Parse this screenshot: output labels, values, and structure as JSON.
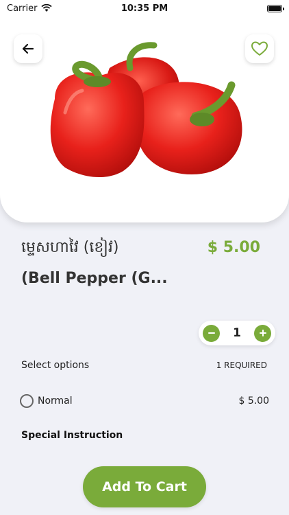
{
  "status_bar": {
    "carrier": "Carrier",
    "time": "10:35 PM"
  },
  "product": {
    "name_line1": "ម្ទេសហាវៃ (ខៀវ)",
    "name_line2": "(Bell Pepper (G...",
    "price": "$ 5.00",
    "image_icon": "red-bell-peppers"
  },
  "quantity": {
    "value": "1"
  },
  "options": {
    "label": "Select options",
    "required": "1 REQUIRED",
    "items": [
      {
        "name": "Normal",
        "price": "$ 5.00",
        "selected": false
      }
    ]
  },
  "special_instruction": "Special Instruction",
  "cart_button": "Add To Cart",
  "colors": {
    "accent": "#7aab3a",
    "background": "#f0f1f7"
  }
}
